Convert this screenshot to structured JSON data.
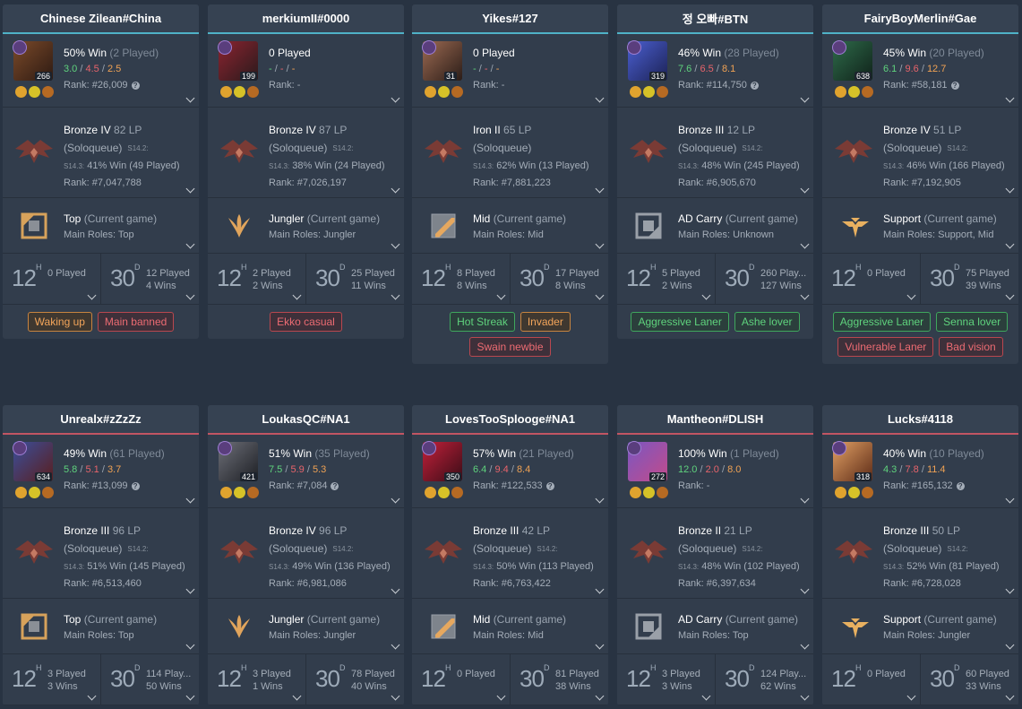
{
  "cards": [
    {
      "name": "Chinese Zilean#China",
      "team": 1,
      "level": "266",
      "portrait": [
        "#7b4a2a",
        "#2d1a12"
      ],
      "win": "50% Win",
      "played": "(2 Played)",
      "k": "3.0",
      "d": "4.5",
      "a": "2.5",
      "rank_line": "Rank: #26,009",
      "help": true,
      "tier": "Bronze IV",
      "lp": "82 LP",
      "queue": "(Soloqueue)",
      "prev": "S14.2:",
      "season": "S14.3:",
      "season_stats": "41% Win (49 Played)",
      "ladder": "Rank: #7,047,788",
      "role": "Top",
      "role_note": "(Current game)",
      "main_roles": "Main Roles: Top",
      "role_icon": "top",
      "h_val": "12",
      "h_unit": "H",
      "h_line1": "0 Played",
      "h_line2": "",
      "d_val": "30",
      "d_unit": "D",
      "d_line1": "12 Played",
      "d_line2": "4 Wins",
      "tags": [
        {
          "t": "Waking up",
          "c": "orange"
        },
        {
          "t": "Main banned",
          "c": "red"
        }
      ]
    },
    {
      "name": "merkiumII#0000",
      "team": 1,
      "level": "199",
      "portrait": [
        "#8b2430",
        "#2a1a1c"
      ],
      "win": "0 Played",
      "played": "",
      "k": "-",
      "d": "-",
      "a": "-",
      "rank_line": "Rank: -",
      "help": false,
      "tier": "Bronze IV",
      "lp": "87 LP",
      "queue": "(Soloqueue)",
      "prev": "S14.2:",
      "season": "S14.3:",
      "season_stats": "38% Win (24 Played)",
      "ladder": "Rank: #7,026,197",
      "role": "Jungler",
      "role_note": "(Current game)",
      "main_roles": "Main Roles: Jungler",
      "role_icon": "jungle",
      "h_val": "12",
      "h_unit": "H",
      "h_line1": "2 Played",
      "h_line2": "2 Wins",
      "d_val": "30",
      "d_unit": "D",
      "d_line1": "25 Played",
      "d_line2": "11 Wins",
      "tags": [
        {
          "t": "Ekko casual",
          "c": "red"
        }
      ]
    },
    {
      "name": "Yikes#127",
      "team": 1,
      "level": "31",
      "portrait": [
        "#9c6a52",
        "#2b1d18"
      ],
      "win": "0 Played",
      "played": "",
      "k": "-",
      "d": "-",
      "a": "-",
      "rank_line": "Rank: -",
      "help": false,
      "tier": "Iron II",
      "lp": "65 LP",
      "queue": "(Soloqueue)",
      "prev": "",
      "season": "S14.3:",
      "season_stats": "62% Win (13 Played)",
      "ladder": "Rank: #7,881,223",
      "role": "Mid",
      "role_note": "(Current game)",
      "main_roles": "Main Roles: Mid",
      "role_icon": "mid",
      "h_val": "12",
      "h_unit": "H",
      "h_line1": "8 Played",
      "h_line2": "8 Wins",
      "d_val": "30",
      "d_unit": "D",
      "d_line1": "17 Played",
      "d_line2": "8 Wins",
      "tags": [
        {
          "t": "Hot Streak",
          "c": "green"
        },
        {
          "t": "Invader",
          "c": "orange"
        },
        {
          "t": "Swain newbie",
          "c": "red"
        }
      ]
    },
    {
      "name": "정 오빠#BTN",
      "team": 1,
      "level": "319",
      "portrait": [
        "#4b5fd1",
        "#1c2255"
      ],
      "win": "46% Win",
      "played": "(28 Played)",
      "k": "7.6",
      "d": "6.5",
      "a": "8.1",
      "rank_line": "Rank: #114,750",
      "help": true,
      "tier": "Bronze III",
      "lp": "12 LP",
      "queue": "(Soloqueue)",
      "prev": "S14.2:",
      "season": "S14.3:",
      "season_stats": "48% Win (245 Played)",
      "ladder": "Rank: #6,905,670",
      "role": "AD Carry",
      "role_note": "(Current game)",
      "main_roles": "Main Roles: Unknown",
      "role_icon": "bot",
      "h_val": "12",
      "h_unit": "H",
      "h_line1": "5 Played",
      "h_line2": "2 Wins",
      "d_val": "30",
      "d_unit": "D",
      "d_line1": "260 Play...",
      "d_line2": "127 Wins",
      "tags": [
        {
          "t": "Aggressive Laner",
          "c": "green"
        },
        {
          "t": "Ashe lover",
          "c": "green"
        }
      ]
    },
    {
      "name": "FairyBoyMerlin#Gae",
      "team": 1,
      "level": "638",
      "portrait": [
        "#2e6b4a",
        "#10221a"
      ],
      "win": "45% Win",
      "played": "(20 Played)",
      "k": "6.1",
      "d": "9.6",
      "a": "12.7",
      "rank_line": "Rank: #58,181",
      "help": true,
      "tier": "Bronze IV",
      "lp": "51 LP",
      "queue": "(Soloqueue)",
      "prev": "S14.2:",
      "season": "S14.3:",
      "season_stats": "46% Win (166 Played)",
      "ladder": "Rank: #7,192,905",
      "role": "Support",
      "role_note": "(Current game)",
      "main_roles": "Main Roles: Support, Mid",
      "role_icon": "support",
      "h_val": "12",
      "h_unit": "H",
      "h_line1": "0 Played",
      "h_line2": "",
      "d_val": "30",
      "d_unit": "D",
      "d_line1": "75 Played",
      "d_line2": "39 Wins",
      "tags": [
        {
          "t": "Aggressive Laner",
          "c": "green"
        },
        {
          "t": "Senna lover",
          "c": "green"
        },
        {
          "t": "Vulnerable Laner",
          "c": "red"
        },
        {
          "t": "Bad vision",
          "c": "red"
        }
      ]
    },
    {
      "name": "Unrealx#zZzZz",
      "team": 2,
      "level": "634",
      "portrait": [
        "#3a4f9b",
        "#5a1e1e"
      ],
      "win": "49% Win",
      "played": "(61 Played)",
      "k": "5.8",
      "d": "5.1",
      "a": "3.7",
      "rank_line": "Rank: #13,099",
      "help": true,
      "tier": "Bronze III",
      "lp": "96 LP",
      "queue": "(Soloqueue)",
      "prev": "S14.2:",
      "season": "S14.3:",
      "season_stats": "51% Win (145 Played)",
      "ladder": "Rank: #6,513,460",
      "role": "Top",
      "role_note": "(Current game)",
      "main_roles": "Main Roles: Top",
      "role_icon": "top",
      "h_val": "12",
      "h_unit": "H",
      "h_line1": "3 Played",
      "h_line2": "3 Wins",
      "d_val": "30",
      "d_unit": "D",
      "d_line1": "114 Play...",
      "d_line2": "50 Wins",
      "tags": []
    },
    {
      "name": "LoukasQC#NA1",
      "team": 2,
      "level": "421",
      "portrait": [
        "#6d6f78",
        "#1d1f24"
      ],
      "win": "51% Win",
      "played": "(35 Played)",
      "k": "7.5",
      "d": "5.9",
      "a": "5.3",
      "rank_line": "Rank: #7,084",
      "help": true,
      "tier": "Bronze IV",
      "lp": "96 LP",
      "queue": "(Soloqueue)",
      "prev": "S14.2:",
      "season": "S14.3:",
      "season_stats": "49% Win (136 Played)",
      "ladder": "Rank: #6,981,086",
      "role": "Jungler",
      "role_note": "(Current game)",
      "main_roles": "Main Roles: Jungler",
      "role_icon": "jungle",
      "h_val": "12",
      "h_unit": "H",
      "h_line1": "3 Played",
      "h_line2": "1 Wins",
      "d_val": "30",
      "d_unit": "D",
      "d_line1": "78 Played",
      "d_line2": "40 Wins",
      "tags": []
    },
    {
      "name": "LovesTooSplooge#NA1",
      "team": 2,
      "level": "350",
      "portrait": [
        "#c2203a",
        "#3a0d17"
      ],
      "win": "57% Win",
      "played": "(21 Played)",
      "k": "6.4",
      "d": "9.4",
      "a": "8.4",
      "rank_line": "Rank: #122,533",
      "help": true,
      "tier": "Bronze III",
      "lp": "42 LP",
      "queue": "(Soloqueue)",
      "prev": "S14.2:",
      "season": "S14.3:",
      "season_stats": "50% Win (113 Played)",
      "ladder": "Rank: #6,763,422",
      "role": "Mid",
      "role_note": "(Current game)",
      "main_roles": "Main Roles: Mid",
      "role_icon": "mid",
      "h_val": "12",
      "h_unit": "H",
      "h_line1": "0 Played",
      "h_line2": "",
      "d_val": "30",
      "d_unit": "D",
      "d_line1": "81 Played",
      "d_line2": "38 Wins",
      "tags": []
    },
    {
      "name": "Mantheon#DLISH",
      "team": 2,
      "level": "272",
      "portrait": [
        "#7a57c2",
        "#c24b8a"
      ],
      "win": "100% Win",
      "played": "(1 Played)",
      "k": "12.0",
      "d": "2.0",
      "a": "8.0",
      "rank_line": "Rank: -",
      "help": false,
      "tier": "Bronze II",
      "lp": "21 LP",
      "queue": "(Soloqueue)",
      "prev": "S14.2:",
      "season": "S14.3:",
      "season_stats": "48% Win (102 Played)",
      "ladder": "Rank: #6,397,634",
      "role": "AD Carry",
      "role_note": "(Current game)",
      "main_roles": "Main Roles: Top",
      "role_icon": "bot",
      "h_val": "12",
      "h_unit": "H",
      "h_line1": "3 Played",
      "h_line2": "3 Wins",
      "d_val": "30",
      "d_unit": "D",
      "d_line1": "124 Play...",
      "d_line2": "62 Wins",
      "tags": []
    },
    {
      "name": "Lucks#4118",
      "team": 2,
      "level": "318",
      "portrait": [
        "#e2a064",
        "#5c2b17"
      ],
      "win": "40% Win",
      "played": "(10 Played)",
      "k": "4.3",
      "d": "7.8",
      "a": "11.4",
      "rank_line": "Rank: #165,132",
      "help": true,
      "tier": "Bronze III",
      "lp": "50 LP",
      "queue": "(Soloqueue)",
      "prev": "S14.2:",
      "season": "S14.3:",
      "season_stats": "52% Win (81 Played)",
      "ladder": "Rank: #6,728,028",
      "role": "Support",
      "role_note": "(Current game)",
      "main_roles": "Main Roles: Jungler",
      "role_icon": "support",
      "h_val": "12",
      "h_unit": "H",
      "h_line1": "0 Played",
      "h_line2": "",
      "d_val": "30",
      "d_unit": "D",
      "d_line1": "60 Played",
      "d_line2": "33 Wins",
      "tags": []
    }
  ],
  "colors": {
    "team1_accent": "#4fb2c7",
    "team2_accent": "#c25563",
    "win_green": "#5fd37d",
    "loss_red": "#e8646b",
    "assist_orange": "#f0a254"
  }
}
